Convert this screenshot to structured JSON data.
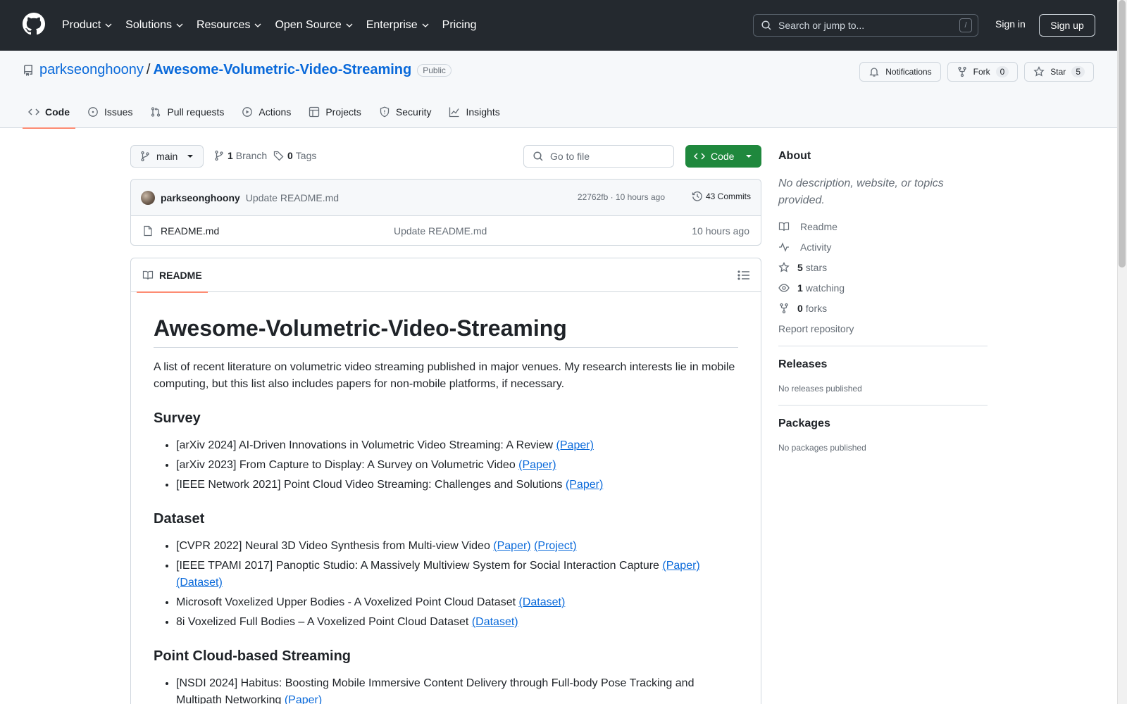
{
  "header": {
    "nav": [
      "Product",
      "Solutions",
      "Resources",
      "Open Source",
      "Enterprise",
      "Pricing"
    ],
    "search_placeholder": "Search or jump to...",
    "search_shortcut": "/",
    "sign_in": "Sign in",
    "sign_up": "Sign up",
    "bg_color": "#24292f"
  },
  "repo": {
    "owner": "parkseonghoony",
    "separator": "/",
    "name": "Awesome-Volumetric-Video-Streaming",
    "visibility": "Public",
    "notifications_label": "Notifications",
    "fork_label": "Fork",
    "fork_count": "0",
    "star_label": "Star",
    "star_count": "5",
    "tabs": [
      "Code",
      "Issues",
      "Pull requests",
      "Actions",
      "Projects",
      "Security",
      "Insights"
    ],
    "active_tab": "Code"
  },
  "files": {
    "branch": "main",
    "branch_count": "1",
    "branch_label": "Branch",
    "tag_count": "0",
    "tag_label": "Tags",
    "goto_placeholder": "Go to file",
    "code_button": "Code",
    "code_button_color": "#1f883d",
    "commit_author": "parkseonghoony",
    "commit_message": "Update README.md",
    "commit_meta": "22762fb · 10 hours ago",
    "commits_label": "43 Commits",
    "rows": [
      {
        "name": "README.md",
        "message": "Update README.md",
        "time": "10 hours ago"
      }
    ]
  },
  "readme": {
    "tab_label": "README",
    "title": "Awesome-Volumetric-Video-Streaming",
    "intro": "A list of recent literature on volumetric video streaming published in major venues. My research interests lie in mobile computing, but this list also includes papers for non-mobile platforms, if necessary.",
    "sections": [
      {
        "heading": "Survey",
        "items": [
          {
            "text": "[arXiv 2024] AI-Driven Innovations in Volumetric Video Streaming: A Review ",
            "links": [
              "(Paper)"
            ]
          },
          {
            "text": "[arXiv 2023] From Capture to Display: A Survey on Volumetric Video ",
            "links": [
              "(Paper)"
            ]
          },
          {
            "text": "[IEEE Network 2021] Point Cloud Video Streaming: Challenges and Solutions ",
            "links": [
              "(Paper)"
            ]
          }
        ]
      },
      {
        "heading": "Dataset",
        "items": [
          {
            "text": "[CVPR 2022] Neural 3D Video Synthesis from Multi-view Video ",
            "links": [
              "(Paper)",
              "(Project)"
            ]
          },
          {
            "text": "[IEEE TPAMI 2017] Panoptic Studio: A Massively Multiview System for Social Interaction Capture ",
            "links": [
              "(Paper)",
              "(Dataset)"
            ]
          },
          {
            "text": "Microsoft Voxelized Upper Bodies - A Voxelized Point Cloud Dataset ",
            "links": [
              "(Dataset)"
            ]
          },
          {
            "text": "8i Voxelized Full Bodies – A Voxelized Point Cloud Dataset ",
            "links": [
              "(Dataset)"
            ]
          }
        ]
      },
      {
        "heading": "Point Cloud-based Streaming",
        "items": [
          {
            "text": "[NSDI 2024] Habitus: Boosting Mobile Immersive Content Delivery through Full-body Pose Tracking and Multipath Networking ",
            "links": [
              "(Paper)"
            ]
          }
        ]
      }
    ]
  },
  "sidebar": {
    "about_heading": "About",
    "about_text": "No description, website, or topics provided.",
    "stats": [
      {
        "icon": "book-icon",
        "bold": "",
        "label": "Readme"
      },
      {
        "icon": "pulse-icon",
        "bold": "",
        "label": "Activity"
      },
      {
        "icon": "star-icon",
        "bold": "5",
        "label": "stars"
      },
      {
        "icon": "eye-icon",
        "bold": "1",
        "label": "watching"
      },
      {
        "icon": "fork-icon",
        "bold": "0",
        "label": "forks"
      }
    ],
    "report": "Report repository",
    "releases_heading": "Releases",
    "releases_text": "No releases published",
    "packages_heading": "Packages",
    "packages_text": "No packages published"
  }
}
